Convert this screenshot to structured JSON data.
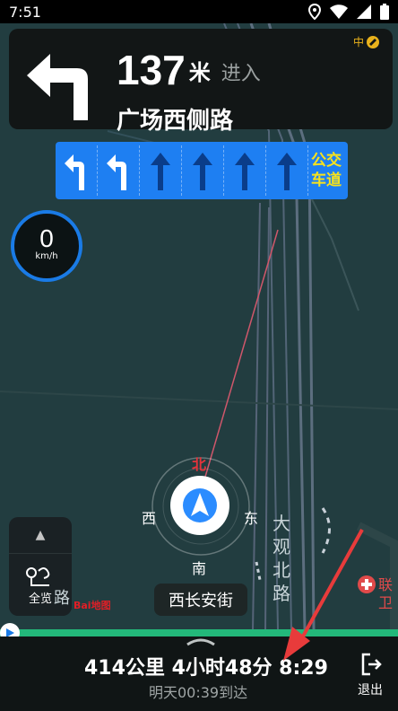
{
  "status_bar": {
    "time": "7:51",
    "icons": [
      "location-icon",
      "wifi-icon",
      "signal-icon",
      "battery-icon"
    ]
  },
  "guidance": {
    "distance_value": "137",
    "distance_unit": "米",
    "action": "进入",
    "road": "广场西侧路",
    "signal_label": "中",
    "turn_icon": "turn-left-arrow-icon"
  },
  "lanes": {
    "icons": [
      "turn-left-icon",
      "turn-left-icon",
      "straight-icon",
      "straight-icon",
      "straight-icon",
      "straight-icon"
    ],
    "bus_label_line1": "公交",
    "bus_label_line2": "车道"
  },
  "speed": {
    "value": "0",
    "unit": "km/h"
  },
  "compass": {
    "north": "北",
    "south": "南",
    "east": "东",
    "west": "西"
  },
  "map_labels": {
    "current_street": "西长安街",
    "vertical_road": "大观北路",
    "road_partial": "路",
    "poi_partial": "联卫",
    "baidu_logo": "Bai地图"
  },
  "side_panel": {
    "overview_label": "全览"
  },
  "trip": {
    "summary": "414公里 4小时48分 8:29",
    "arrival": "明天00:39到达"
  },
  "actions": {
    "exit_label": "退出"
  },
  "colors": {
    "lane_bg": "#1e7ff2",
    "route_green": "#23b87a",
    "bus_lane_text": "#f7e21c",
    "north_red": "#e5343b"
  }
}
